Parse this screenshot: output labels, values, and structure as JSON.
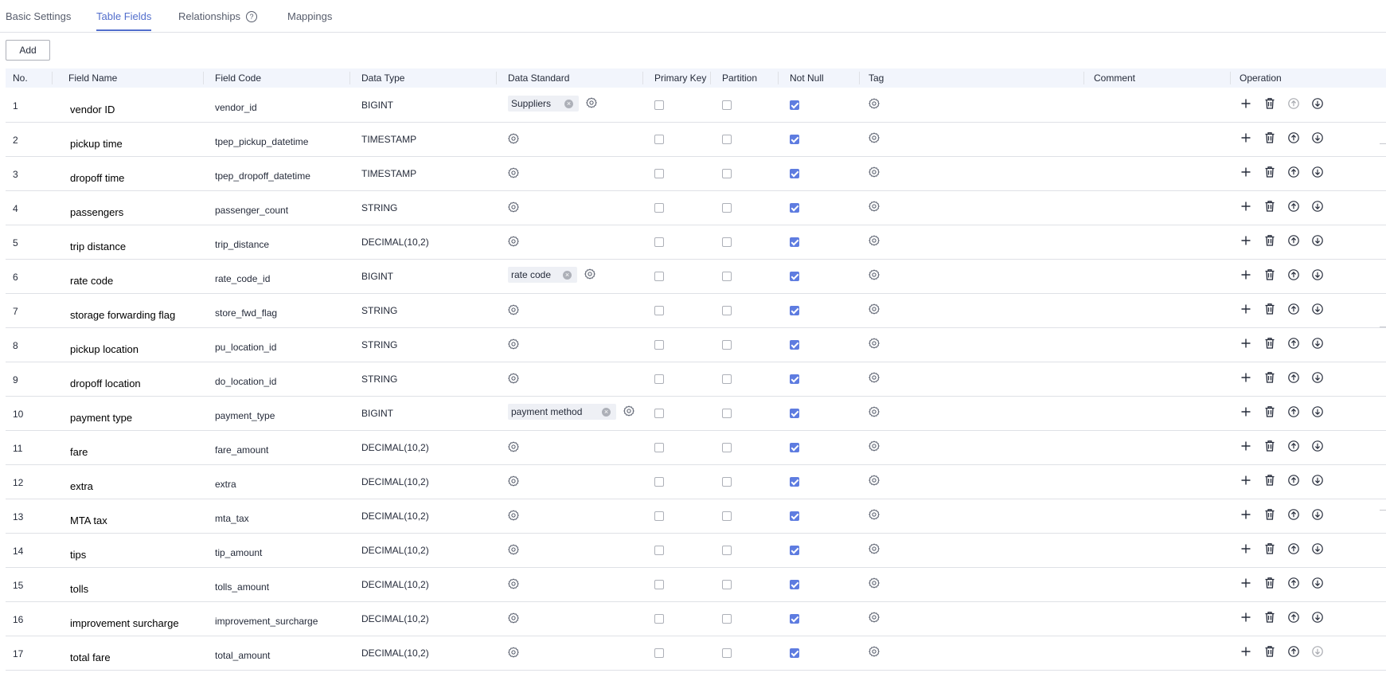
{
  "tabs": [
    {
      "label": "Basic Settings",
      "active": false
    },
    {
      "label": "Table Fields",
      "active": true
    },
    {
      "label": "Relationships",
      "active": false,
      "help_icon": "help-circle-icon"
    },
    {
      "label": "Mappings",
      "active": false
    }
  ],
  "toolbar": {
    "add_label": "Add"
  },
  "table": {
    "headers": [
      "No.",
      "Field Name",
      "Field Code",
      "Data Type",
      "Data Standard",
      "Primary Key",
      "Partition",
      "Not Null",
      "Tag",
      "Comment",
      "Operation"
    ],
    "rows": [
      {
        "no": "1",
        "name": "vendor ID",
        "code": "vendor_id",
        "type": "BIGINT",
        "standard": "Suppliers",
        "pk": false,
        "partition": false,
        "not_null": true,
        "comment": "",
        "move_up_enabled": false,
        "move_down_enabled": true
      },
      {
        "no": "2",
        "name": "pickup time",
        "code": "tpep_pickup_datetime",
        "type": "TIMESTAMP",
        "standard": "",
        "pk": false,
        "partition": false,
        "not_null": true,
        "comment": "",
        "move_up_enabled": true,
        "move_down_enabled": true
      },
      {
        "no": "3",
        "name": "dropoff time",
        "code": "tpep_dropoff_datetime",
        "type": "TIMESTAMP",
        "standard": "",
        "pk": false,
        "partition": false,
        "not_null": true,
        "comment": "",
        "move_up_enabled": true,
        "move_down_enabled": true
      },
      {
        "no": "4",
        "name": "passengers",
        "code": "passenger_count",
        "type": "STRING",
        "standard": "",
        "pk": false,
        "partition": false,
        "not_null": true,
        "comment": "",
        "move_up_enabled": true,
        "move_down_enabled": true
      },
      {
        "no": "5",
        "name": "trip distance",
        "code": "trip_distance",
        "type": "DECIMAL(10,2)",
        "standard": "",
        "pk": false,
        "partition": false,
        "not_null": true,
        "comment": "",
        "move_up_enabled": true,
        "move_down_enabled": true
      },
      {
        "no": "6",
        "name": "rate code",
        "code": "rate_code_id",
        "type": "BIGINT",
        "standard": "rate code",
        "pk": false,
        "partition": false,
        "not_null": true,
        "comment": "",
        "move_up_enabled": true,
        "move_down_enabled": true
      },
      {
        "no": "7",
        "name": "storage forwarding flag",
        "code": "store_fwd_flag",
        "type": "STRING",
        "standard": "",
        "pk": false,
        "partition": false,
        "not_null": true,
        "comment": "",
        "move_up_enabled": true,
        "move_down_enabled": true
      },
      {
        "no": "8",
        "name": "pickup location",
        "code": "pu_location_id",
        "type": "STRING",
        "standard": "",
        "pk": false,
        "partition": false,
        "not_null": true,
        "comment": "",
        "move_up_enabled": true,
        "move_down_enabled": true
      },
      {
        "no": "9",
        "name": "dropoff location",
        "code": "do_location_id",
        "type": "STRING",
        "standard": "",
        "pk": false,
        "partition": false,
        "not_null": true,
        "comment": "",
        "move_up_enabled": true,
        "move_down_enabled": true
      },
      {
        "no": "10",
        "name": "payment type",
        "code": "payment_type",
        "type": "BIGINT",
        "standard": "payment method",
        "pk": false,
        "partition": false,
        "not_null": true,
        "comment": "",
        "move_up_enabled": true,
        "move_down_enabled": true
      },
      {
        "no": "11",
        "name": "fare",
        "code": "fare_amount",
        "type": "DECIMAL(10,2)",
        "standard": "",
        "pk": false,
        "partition": false,
        "not_null": true,
        "comment": "",
        "move_up_enabled": true,
        "move_down_enabled": true
      },
      {
        "no": "12",
        "name": "extra",
        "code": "extra",
        "type": "DECIMAL(10,2)",
        "standard": "",
        "pk": false,
        "partition": false,
        "not_null": true,
        "comment": "",
        "move_up_enabled": true,
        "move_down_enabled": true
      },
      {
        "no": "13",
        "name": "MTA tax",
        "code": "mta_tax",
        "type": "DECIMAL(10,2)",
        "standard": "",
        "pk": false,
        "partition": false,
        "not_null": true,
        "comment": "",
        "move_up_enabled": true,
        "move_down_enabled": true
      },
      {
        "no": "14",
        "name": "tips",
        "code": "tip_amount",
        "type": "DECIMAL(10,2)",
        "standard": "",
        "pk": false,
        "partition": false,
        "not_null": true,
        "comment": "",
        "move_up_enabled": true,
        "move_down_enabled": true
      },
      {
        "no": "15",
        "name": "tolls",
        "code": "tolls_amount",
        "type": "DECIMAL(10,2)",
        "standard": "",
        "pk": false,
        "partition": false,
        "not_null": true,
        "comment": "",
        "move_up_enabled": true,
        "move_down_enabled": true
      },
      {
        "no": "16",
        "name": "improvement surcharge",
        "code": "improvement_surcharge",
        "type": "DECIMAL(10,2)",
        "standard": "",
        "pk": false,
        "partition": false,
        "not_null": true,
        "comment": "",
        "move_up_enabled": true,
        "move_down_enabled": true
      },
      {
        "no": "17",
        "name": "total fare",
        "code": "total_amount",
        "type": "DECIMAL(10,2)",
        "standard": "",
        "pk": false,
        "partition": false,
        "not_null": true,
        "comment": "",
        "move_up_enabled": true,
        "move_down_enabled": false
      }
    ]
  },
  "icons": {
    "standard_settings": "gear-icon",
    "tag_settings": "gear-icon",
    "remove_standard": "clear-icon",
    "add_row": "plus-icon",
    "delete_row": "trash-icon",
    "move_up": "arrow-up-circle-icon",
    "move_down": "arrow-down-circle-icon"
  },
  "colors": {
    "accent": "#526ecc",
    "checkbox_checked": "#5e7ce0",
    "header_bg": "#f2f5fc",
    "border": "#dfe1e6"
  }
}
